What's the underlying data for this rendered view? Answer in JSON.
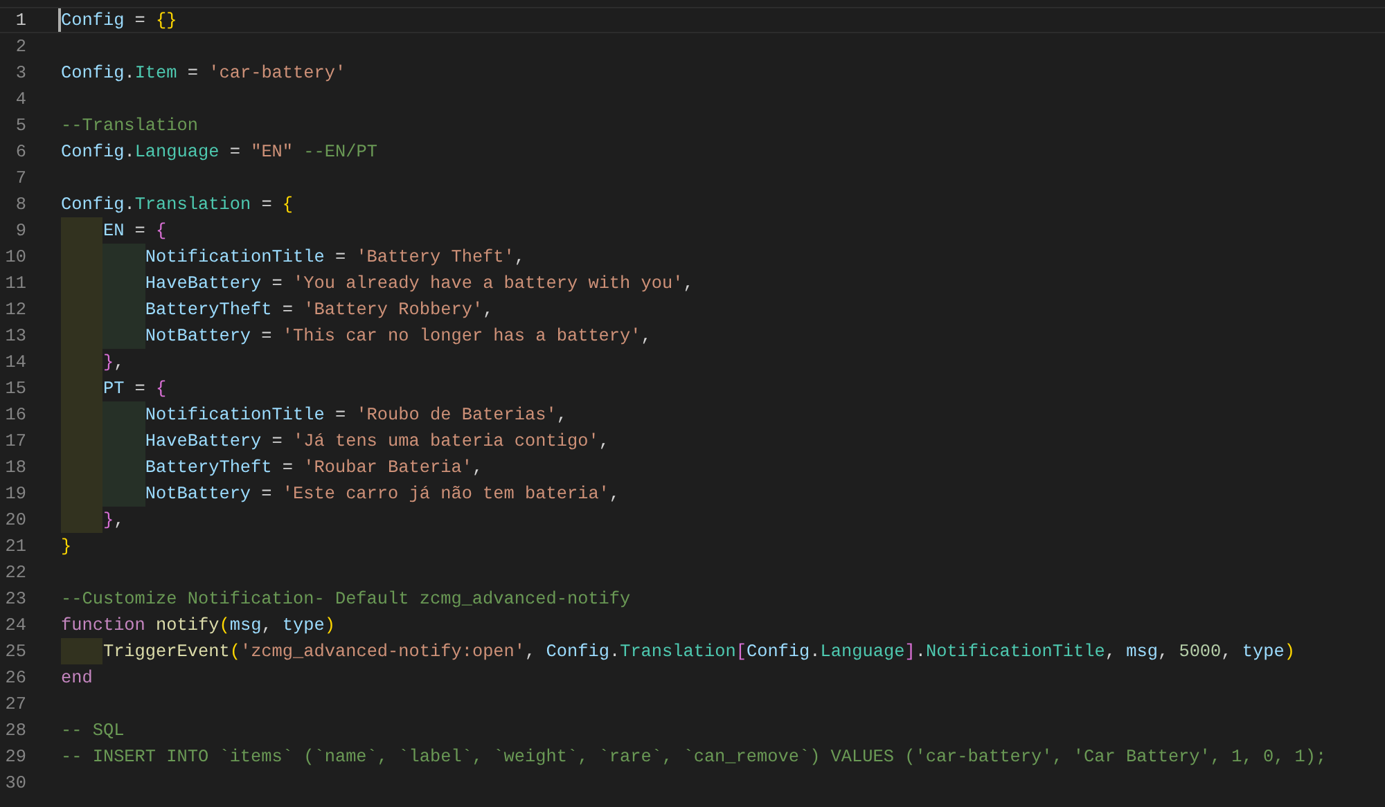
{
  "editor": {
    "lines": [
      {
        "number": "1",
        "current": true,
        "tokens": [
          {
            "kind": "var",
            "text": "Config"
          },
          {
            "kind": "op",
            "text": " = "
          },
          {
            "kind": "bracket1",
            "text": "{}"
          }
        ]
      },
      {
        "number": "2",
        "current": false
      },
      {
        "number": "3",
        "current": false,
        "tokens": [
          {
            "kind": "var",
            "text": "Config"
          },
          {
            "kind": "op",
            "text": "."
          },
          {
            "kind": "prop",
            "text": "Item"
          },
          {
            "kind": "op",
            "text": " = "
          },
          {
            "kind": "str",
            "text": "'car-battery'"
          }
        ]
      },
      {
        "number": "4",
        "current": false
      },
      {
        "number": "5",
        "current": false,
        "tokens": [
          {
            "kind": "comment",
            "text": "--Translation"
          }
        ]
      },
      {
        "number": "6",
        "current": false,
        "tokens": [
          {
            "kind": "var",
            "text": "Config"
          },
          {
            "kind": "op",
            "text": "."
          },
          {
            "kind": "prop",
            "text": "Language"
          },
          {
            "kind": "op",
            "text": " = "
          },
          {
            "kind": "str",
            "text": "\"EN\" "
          },
          {
            "kind": "comment",
            "text": "--EN/PT"
          }
        ]
      },
      {
        "number": "7",
        "current": false
      },
      {
        "number": "8",
        "current": false,
        "tokens": [
          {
            "kind": "var",
            "text": "Config"
          },
          {
            "kind": "op",
            "text": "."
          },
          {
            "kind": "prop",
            "text": "Translation"
          },
          {
            "kind": "op",
            "text": " = "
          },
          {
            "kind": "bracket1",
            "text": "{"
          }
        ]
      },
      {
        "number": "9",
        "current": false,
        "guides": [
          {
            "color": "#32321f"
          }
        ],
        "tokens": [
          {
            "kind": "var",
            "text": "EN"
          },
          {
            "kind": "op",
            "text": " = "
          },
          {
            "kind": "bracket2",
            "text": "{"
          }
        ]
      },
      {
        "number": "10",
        "current": false,
        "guides": [
          {
            "color": "#32321f"
          },
          {
            "color": "#263027"
          }
        ],
        "tokens": [
          {
            "kind": "var",
            "text": "NotificationTitle"
          },
          {
            "kind": "op",
            "text": " = "
          },
          {
            "kind": "str",
            "text": "'Battery Theft'"
          },
          {
            "kind": "op",
            "text": ","
          }
        ]
      },
      {
        "number": "11",
        "current": false,
        "guides": [
          {
            "color": "#32321f"
          },
          {
            "color": "#263027"
          }
        ],
        "tokens": [
          {
            "kind": "var",
            "text": "HaveBattery"
          },
          {
            "kind": "op",
            "text": " = "
          },
          {
            "kind": "str",
            "text": "'You already have a battery with you'"
          },
          {
            "kind": "op",
            "text": ","
          }
        ]
      },
      {
        "number": "12",
        "current": false,
        "guides": [
          {
            "color": "#32321f"
          },
          {
            "color": "#263027"
          }
        ],
        "tokens": [
          {
            "kind": "var",
            "text": "BatteryTheft"
          },
          {
            "kind": "op",
            "text": " = "
          },
          {
            "kind": "str",
            "text": "'Battery Robbery'"
          },
          {
            "kind": "op",
            "text": ","
          }
        ]
      },
      {
        "number": "13",
        "current": false,
        "guides": [
          {
            "color": "#32321f"
          },
          {
            "color": "#263027"
          }
        ],
        "tokens": [
          {
            "kind": "var",
            "text": "NotBattery"
          },
          {
            "kind": "op",
            "text": " = "
          },
          {
            "kind": "str",
            "text": "'This car no longer has a battery'"
          },
          {
            "kind": "op",
            "text": ","
          }
        ]
      },
      {
        "number": "14",
        "current": false,
        "guides": [
          {
            "color": "#32321f"
          }
        ],
        "tokens": [
          {
            "kind": "bracket2",
            "text": "}"
          },
          {
            "kind": "op",
            "text": ","
          }
        ]
      },
      {
        "number": "15",
        "current": false,
        "guides": [
          {
            "color": "#32321f"
          }
        ],
        "tokens": [
          {
            "kind": "var",
            "text": "PT"
          },
          {
            "kind": "op",
            "text": " = "
          },
          {
            "kind": "bracket2",
            "text": "{"
          }
        ]
      },
      {
        "number": "16",
        "current": false,
        "guides": [
          {
            "color": "#32321f"
          },
          {
            "color": "#263027"
          }
        ],
        "tokens": [
          {
            "kind": "var",
            "text": "NotificationTitle"
          },
          {
            "kind": "op",
            "text": " = "
          },
          {
            "kind": "str",
            "text": "'Roubo de Baterias'"
          },
          {
            "kind": "op",
            "text": ","
          }
        ]
      },
      {
        "number": "17",
        "current": false,
        "guides": [
          {
            "color": "#32321f"
          },
          {
            "color": "#263027"
          }
        ],
        "tokens": [
          {
            "kind": "var",
            "text": "HaveBattery"
          },
          {
            "kind": "op",
            "text": " = "
          },
          {
            "kind": "str",
            "text": "'Já tens uma bateria contigo'"
          },
          {
            "kind": "op",
            "text": ","
          }
        ]
      },
      {
        "number": "18",
        "current": false,
        "guides": [
          {
            "color": "#32321f"
          },
          {
            "color": "#263027"
          }
        ],
        "tokens": [
          {
            "kind": "var",
            "text": "BatteryTheft"
          },
          {
            "kind": "op",
            "text": " = "
          },
          {
            "kind": "str",
            "text": "'Roubar Bateria'"
          },
          {
            "kind": "op",
            "text": ","
          }
        ]
      },
      {
        "number": "19",
        "current": false,
        "guides": [
          {
            "color": "#32321f"
          },
          {
            "color": "#263027"
          }
        ],
        "tokens": [
          {
            "kind": "var",
            "text": "NotBattery"
          },
          {
            "kind": "op",
            "text": " = "
          },
          {
            "kind": "str",
            "text": "'Este carro já não tem bateria'"
          },
          {
            "kind": "op",
            "text": ","
          }
        ]
      },
      {
        "number": "20",
        "current": false,
        "guides": [
          {
            "color": "#32321f"
          }
        ],
        "tokens": [
          {
            "kind": "bracket2",
            "text": "}"
          },
          {
            "kind": "op",
            "text": ","
          }
        ]
      },
      {
        "number": "21",
        "current": false,
        "tokens": [
          {
            "kind": "bracket1",
            "text": "}"
          }
        ]
      },
      {
        "number": "22",
        "current": false
      },
      {
        "number": "23",
        "current": false,
        "tokens": [
          {
            "kind": "comment",
            "text": "--Customize Notification- Default zcmg_advanced-notify"
          }
        ]
      },
      {
        "number": "24",
        "current": false,
        "tokens": [
          {
            "kind": "keyword",
            "text": "function "
          },
          {
            "kind": "func",
            "text": "notify"
          },
          {
            "kind": "bracket1",
            "text": "("
          },
          {
            "kind": "var",
            "text": "msg"
          },
          {
            "kind": "op",
            "text": ", "
          },
          {
            "kind": "var",
            "text": "type"
          },
          {
            "kind": "bracket1",
            "text": ")"
          }
        ]
      },
      {
        "number": "25",
        "current": false,
        "guides": [
          {
            "color": "#32321f"
          }
        ],
        "tokens": [
          {
            "kind": "func",
            "text": "TriggerEvent"
          },
          {
            "kind": "bracket1",
            "text": "("
          },
          {
            "kind": "str",
            "text": "'zcmg_advanced-notify:open'"
          },
          {
            "kind": "op",
            "text": ", "
          },
          {
            "kind": "var",
            "text": "Config"
          },
          {
            "kind": "op",
            "text": "."
          },
          {
            "kind": "prop",
            "text": "Translation"
          },
          {
            "kind": "bracket2",
            "text": "["
          },
          {
            "kind": "var",
            "text": "Config"
          },
          {
            "kind": "op",
            "text": "."
          },
          {
            "kind": "prop",
            "text": "Language"
          },
          {
            "kind": "bracket2",
            "text": "]"
          },
          {
            "kind": "op",
            "text": "."
          },
          {
            "kind": "prop",
            "text": "NotificationTitle"
          },
          {
            "kind": "op",
            "text": ", "
          },
          {
            "kind": "var",
            "text": "msg"
          },
          {
            "kind": "op",
            "text": ", "
          },
          {
            "kind": "num",
            "text": "5000"
          },
          {
            "kind": "op",
            "text": ", "
          },
          {
            "kind": "var",
            "text": "type"
          },
          {
            "kind": "bracket1",
            "text": ")"
          }
        ]
      },
      {
        "number": "26",
        "current": false,
        "tokens": [
          {
            "kind": "keyword",
            "text": "end"
          }
        ]
      },
      {
        "number": "27",
        "current": false
      },
      {
        "number": "28",
        "current": false,
        "tokens": [
          {
            "kind": "comment",
            "text": "-- SQL"
          }
        ]
      },
      {
        "number": "29",
        "current": false,
        "tokens": [
          {
            "kind": "comment",
            "text": "-- INSERT INTO `items` (`name`, `label`, `weight`, `rare`, `can_remove`) VALUES ('car-battery', 'Car Battery', 1, 0, 1);"
          }
        ]
      },
      {
        "number": "30",
        "current": false
      }
    ]
  }
}
